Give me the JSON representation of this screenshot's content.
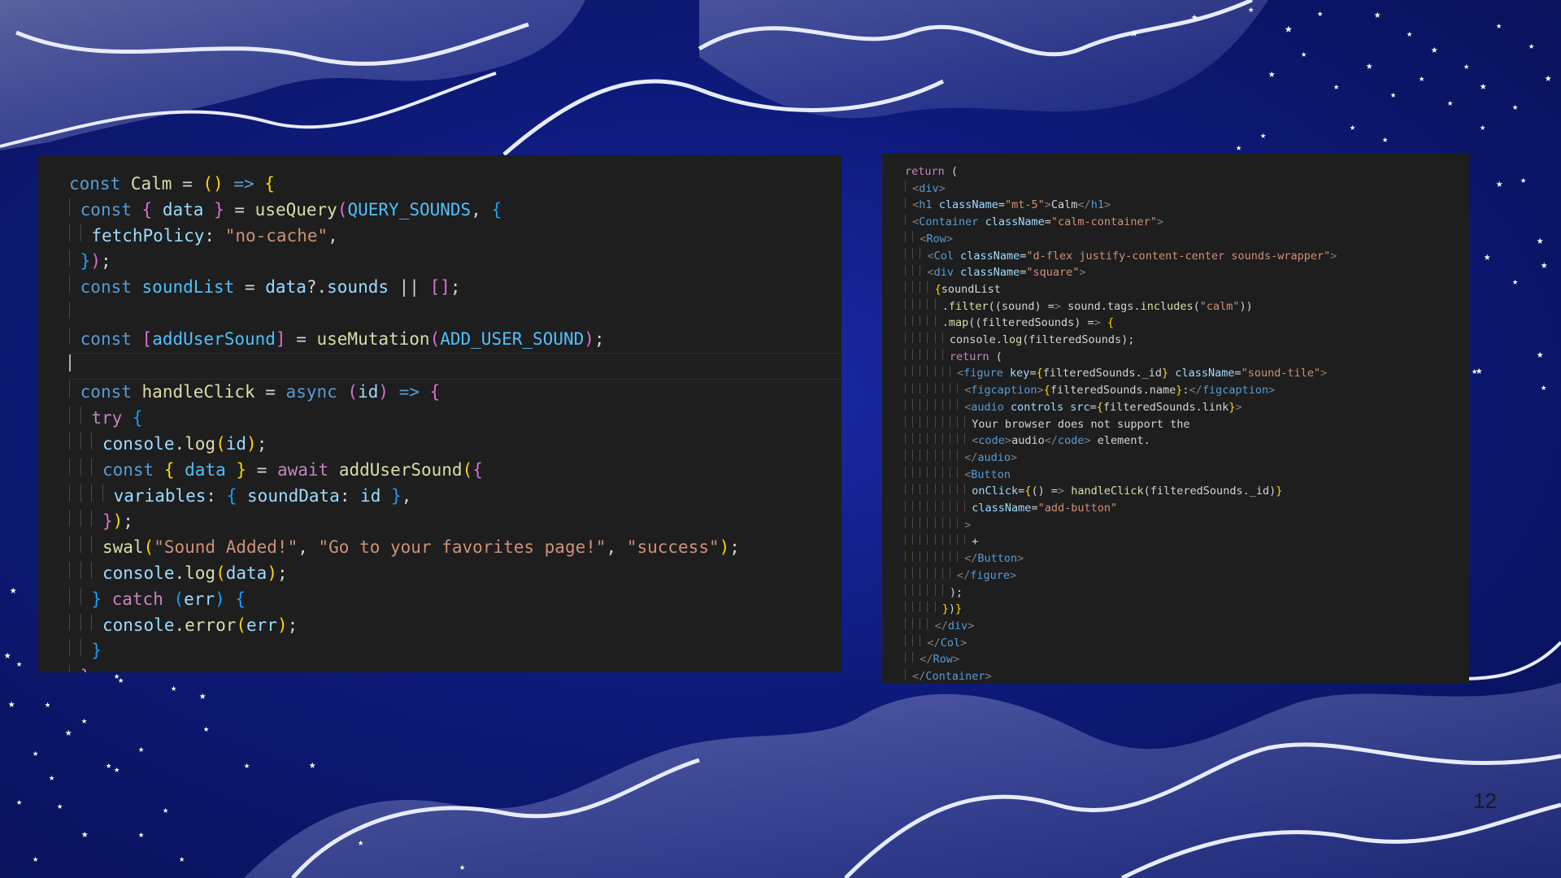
{
  "slide": {
    "page_number": "12"
  },
  "left_code": {
    "lines": [
      "const Calm = () => {",
      "  const { data } = useQuery(QUERY_SOUNDS, {",
      "    fetchPolicy: \"no-cache\",",
      "  });",
      "  const soundList = data?.sounds || [];",
      "",
      "  const [addUserSound] = useMutation(ADD_USER_SOUND);",
      "",
      "  const handleClick = async (id) => {",
      "    try {",
      "      console.log(id);",
      "      const { data } = await addUserSound({",
      "        variables: { soundData: id },",
      "      });",
      "      swal(\"Sound Added!\", \"Go to your favorites page!\", \"success\");",
      "      console.log(data);",
      "    } catch (err) {",
      "      console.error(err);",
      "    }",
      "  };"
    ]
  },
  "right_code": {
    "lines": [
      "return (",
      "  <div>",
      "  <h1 className=\"mt-5\">Calm</h1>",
      "  <Container className=\"calm-container\">",
      "    <Row>",
      "      <Col className=\"d-flex justify-content-center sounds-wrapper\">",
      "      <div className=\"square\">",
      "        {soundList",
      "          .filter((sound) => sound.tags.includes(\"calm\"))",
      "          .map((filteredSounds) => {",
      "            console.log(filteredSounds);",
      "            return (",
      "              <figure key={filteredSounds._id} className=\"sound-tile\">",
      "                <figcaption>{filteredSounds.name}:</figcaption>",
      "                <audio controls src={filteredSounds.link}>",
      "                  Your browser does not support the",
      "                  <code>audio</code> element.",
      "                </audio>",
      "                <Button",
      "                  onClick={() => handleClick(filteredSounds._id)}",
      "                  className=\"add-button\"",
      "                >",
      "                  +",
      "                </Button>",
      "              </figure>",
      "            );",
      "          })}",
      "        </div>",
      "      </Col>",
      "    </Row>",
      "  </Container>"
    ]
  },
  "colors": {
    "keyword": "#569cd6",
    "control": "#c586c0",
    "function": "#dcdcaa",
    "variable": "#9cdcfe",
    "string": "#ce9178",
    "constant": "#4fc1ff",
    "bracket_gold": "#ffd700",
    "bracket_pink": "#da70d6",
    "bracket_blue": "#179fff",
    "editor_bg": "#1e1e1e"
  }
}
